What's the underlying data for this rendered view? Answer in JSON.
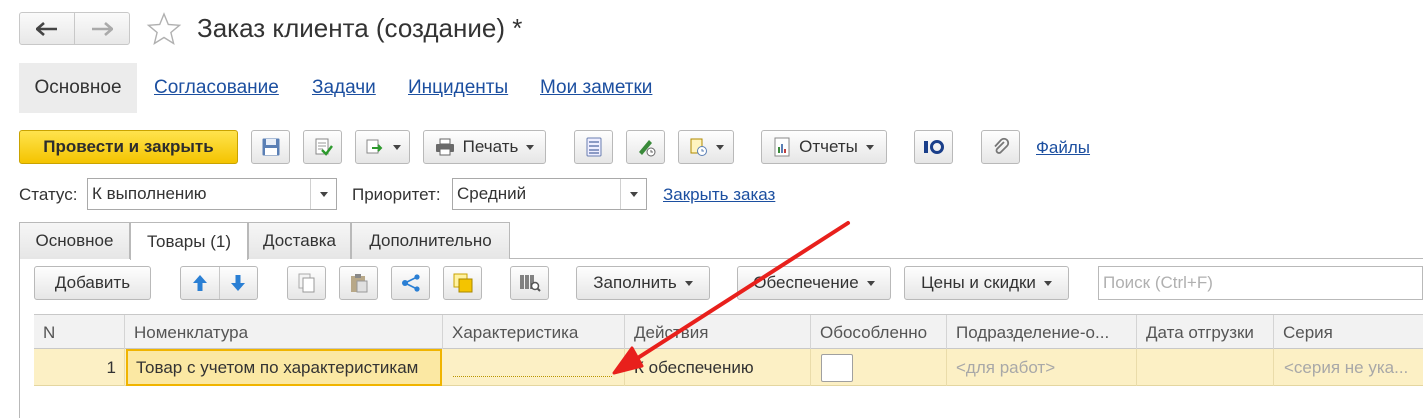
{
  "header": {
    "title": "Заказ клиента (создание) *",
    "back_icon": "arrow-left-icon",
    "forward_icon": "arrow-right-icon",
    "favorite_icon": "star-icon"
  },
  "top_tabs": [
    {
      "label": "Основное",
      "active": true
    },
    {
      "label": "Согласование"
    },
    {
      "label": "Задачи"
    },
    {
      "label": "Инциденты"
    },
    {
      "label": "Мои заметки"
    }
  ],
  "toolbar": {
    "post_close": "Провести и закрыть",
    "print": "Печать",
    "reports": "Отчеты",
    "files": "Файлы"
  },
  "status": {
    "status_label": "Статус:",
    "status_value": "К выполнению",
    "priority_label": "Приоритет:",
    "priority_value": "Средний",
    "close_order": "Закрыть заказ"
  },
  "inner_tabs": [
    {
      "label": "Основное"
    },
    {
      "label": "Товары (1)",
      "active": true
    },
    {
      "label": "Доставка"
    },
    {
      "label": "Дополнительно"
    }
  ],
  "table_toolbar": {
    "add": "Добавить",
    "fill": "Заполнить",
    "supply": "Обеспечение",
    "prices": "Цены и скидки",
    "search_placeholder": "Поиск (Ctrl+F)"
  },
  "table": {
    "columns": [
      "N",
      "Номенклатура",
      "Характеристика",
      "Действия",
      "Обособленно",
      "Подразделение-о...",
      "Дата отгрузки",
      "Серия"
    ],
    "rows": [
      {
        "n": "1",
        "item": "Товар с учетом по характеристикам",
        "characteristic": "",
        "action": "К обеспечению",
        "separate": false,
        "division": "<для работ>",
        "ship_date": "",
        "series": "<серия не ука..."
      }
    ]
  },
  "colors": {
    "accent_yellow": "#f4c400",
    "link_blue": "#1c4fa0",
    "row_highlight": "#fcf0c5",
    "annotation_arrow": "#e8201c"
  }
}
